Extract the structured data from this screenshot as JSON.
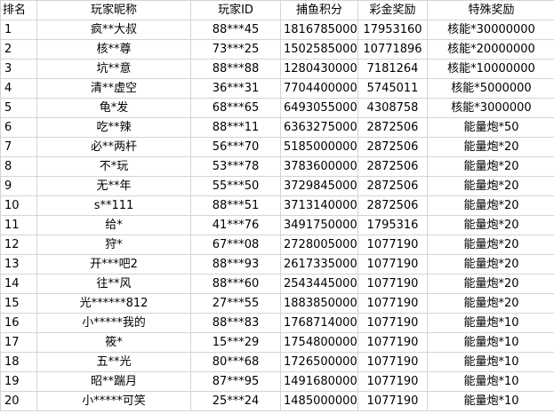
{
  "columns": {
    "rank": "排名",
    "nickname": "玩家昵称",
    "player_id": "玩家ID",
    "fish_points": "捕鱼积分",
    "jackpot": "彩金奖励",
    "special_reward": "特殊奖励"
  },
  "rows": [
    {
      "rank": "1",
      "nickname": "疯**大叔",
      "player_id": "88***45",
      "fish_points": "18167850000",
      "jackpot": "17953160",
      "special_reward": "核能*30000000"
    },
    {
      "rank": "2",
      "nickname": "核**尊",
      "player_id": "73***25",
      "fish_points": "15025850000",
      "jackpot": "10771896",
      "special_reward": "核能*20000000"
    },
    {
      "rank": "3",
      "nickname": "坑**意",
      "player_id": "88***88",
      "fish_points": "12804300000",
      "jackpot": "7181264",
      "special_reward": "核能*10000000"
    },
    {
      "rank": "4",
      "nickname": "清**虚空",
      "player_id": "36***31",
      "fish_points": "7704400000",
      "jackpot": "5745011",
      "special_reward": "核能*5000000"
    },
    {
      "rank": "5",
      "nickname": "龟*发",
      "player_id": "68***65",
      "fish_points": "6493055000",
      "jackpot": "4308758",
      "special_reward": "核能*3000000"
    },
    {
      "rank": "6",
      "nickname": "吃**辣",
      "player_id": "88***11",
      "fish_points": "6363275000",
      "jackpot": "2872506",
      "special_reward": "能量炮*50"
    },
    {
      "rank": "7",
      "nickname": "必**两杆",
      "player_id": "56***70",
      "fish_points": "5185000000",
      "jackpot": "2872506",
      "special_reward": "能量炮*20"
    },
    {
      "rank": "8",
      "nickname": "不*玩",
      "player_id": "53***78",
      "fish_points": "3783600000",
      "jackpot": "2872506",
      "special_reward": "能量炮*20"
    },
    {
      "rank": "9",
      "nickname": "无**年",
      "player_id": "55***50",
      "fish_points": "3729845000",
      "jackpot": "2872506",
      "special_reward": "能量炮*20"
    },
    {
      "rank": "10",
      "nickname": "s**111",
      "player_id": "88***51",
      "fish_points": "3713140000",
      "jackpot": "2872506",
      "special_reward": "能量炮*20"
    },
    {
      "rank": "11",
      "nickname": "给*",
      "player_id": "41***76",
      "fish_points": "3491750000",
      "jackpot": "1795316",
      "special_reward": "能量炮*20"
    },
    {
      "rank": "12",
      "nickname": "狩*",
      "player_id": "67***08",
      "fish_points": "2728005000",
      "jackpot": "1077190",
      "special_reward": "能量炮*20"
    },
    {
      "rank": "13",
      "nickname": "开***吧2",
      "player_id": "88***93",
      "fish_points": "2617335000",
      "jackpot": "1077190",
      "special_reward": "能量炮*20"
    },
    {
      "rank": "14",
      "nickname": "往**风",
      "player_id": "88***60",
      "fish_points": "2543445000",
      "jackpot": "1077190",
      "special_reward": "能量炮*20"
    },
    {
      "rank": "15",
      "nickname": "光******812",
      "player_id": "27***55",
      "fish_points": "1883850000",
      "jackpot": "1077190",
      "special_reward": "能量炮*20"
    },
    {
      "rank": "16",
      "nickname": "小*****我的",
      "player_id": "88***83",
      "fish_points": "1768714000",
      "jackpot": "1077190",
      "special_reward": "能量炮*10"
    },
    {
      "rank": "17",
      "nickname": "筱*",
      "player_id": "15***29",
      "fish_points": "1754800000",
      "jackpot": "1077190",
      "special_reward": "能量炮*10"
    },
    {
      "rank": "18",
      "nickname": "五**光",
      "player_id": "80***68",
      "fish_points": "1726500000",
      "jackpot": "1077190",
      "special_reward": "能量炮*10"
    },
    {
      "rank": "19",
      "nickname": "昭**踹月",
      "player_id": "87***95",
      "fish_points": "1491680000",
      "jackpot": "1077190",
      "special_reward": "能量炮*10"
    },
    {
      "rank": "20",
      "nickname": "小*****可笑",
      "player_id": "25***24",
      "fish_points": "1485000000",
      "jackpot": "1077190",
      "special_reward": "能量炮*10"
    }
  ]
}
